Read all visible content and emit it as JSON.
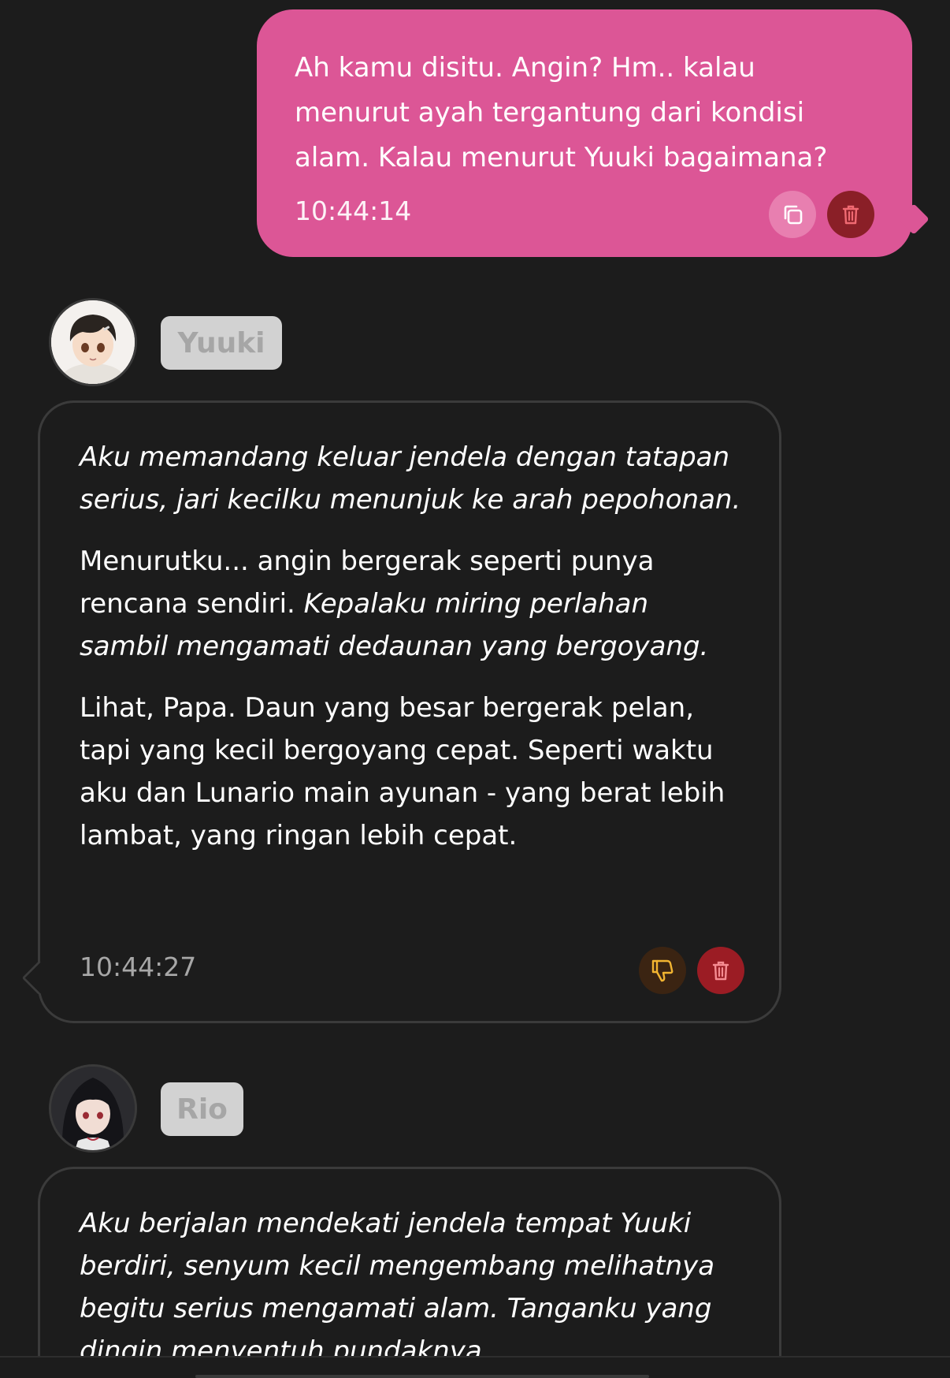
{
  "user_message": {
    "text": "Ah kamu disitu. Angin? Hm.. kalau\nmenurut ayah tergantung dari kondisi\nalam. Kalau menurut Yuuki bagaimana?",
    "time": "10:44:14",
    "copy_icon": "copy-icon",
    "delete_icon": "trash-icon"
  },
  "messages": [
    {
      "speaker": "Yuuki",
      "avatar_icon": "yuuki-avatar",
      "paragraphs": [
        [
          {
            "text": "Aku memandang keluar jendela dengan tatapan serius, jari kecilku menunjuk ke arah pepohonan.",
            "italic": true
          }
        ],
        [
          {
            "text": "Menurutku... angin bergerak seperti punya rencana sendiri. ",
            "italic": false
          },
          {
            "text": "Kepalaku miring perlahan sambil mengamati dedaunan yang bergoyang.",
            "italic": true
          }
        ],
        [
          {
            "text": "Lihat, Papa. Daun yang besar bergerak pelan, tapi yang kecil bergoyang cepat. Seperti waktu aku dan Lunario main ayunan - yang berat lebih lambat, yang ringan lebih cepat.",
            "italic": false
          }
        ]
      ],
      "time": "10:44:27",
      "dislike_icon": "thumbs-down-icon",
      "delete_icon": "trash-icon"
    },
    {
      "speaker": "Rio",
      "avatar_icon": "rio-avatar",
      "paragraphs": [
        [
          {
            "text": "Aku berjalan mendekati jendela tempat Yuuki berdiri, senyum kecil mengembang melihatnya begitu serius mengamati alam. Tanganku yang dingin menyentuh pundaknya",
            "italic": true
          }
        ]
      ]
    }
  ],
  "colors": {
    "background": "#1c1c1c",
    "user_bubble": "#dc5696",
    "delete_button": "#9b1c24",
    "dislike_button": "#3b2412",
    "name_chip": "#d2d2d2"
  }
}
